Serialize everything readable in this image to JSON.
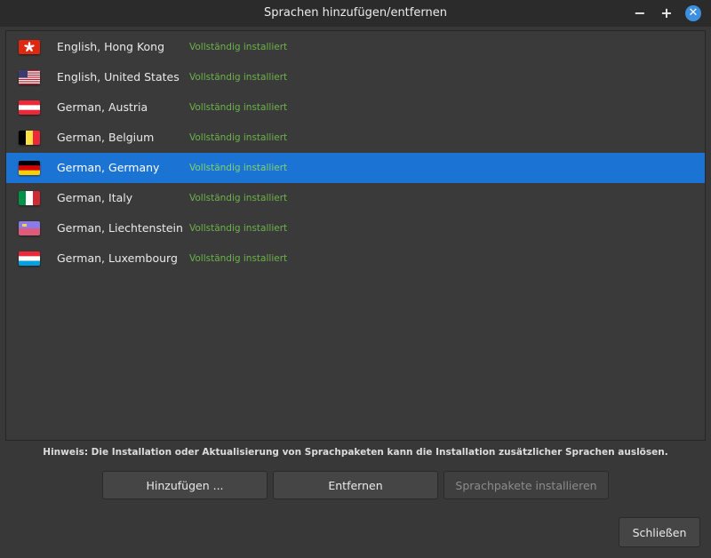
{
  "window": {
    "title": "Sprachen hinzufügen/entfernen",
    "minimize_glyph": "−",
    "maximize_glyph": "+",
    "close_glyph": "✕"
  },
  "languages": [
    {
      "name": "English, Hong Kong",
      "status": "Vollständig installiert",
      "flag": "hk-flag-icon",
      "selected": false
    },
    {
      "name": "English, United States",
      "status": "Vollständig installiert",
      "flag": "us-flag-icon",
      "selected": false
    },
    {
      "name": "German, Austria",
      "status": "Vollständig installiert",
      "flag": "at-flag-icon",
      "selected": false
    },
    {
      "name": "German, Belgium",
      "status": "Vollständig installiert",
      "flag": "be-flag-icon",
      "selected": false
    },
    {
      "name": "German, Germany",
      "status": "Vollständig installiert",
      "flag": "de-flag-icon",
      "selected": true
    },
    {
      "name": "German, Italy",
      "status": "Vollständig installiert",
      "flag": "it-flag-icon",
      "selected": false
    },
    {
      "name": "German, Liechtenstein",
      "status": "Vollständig installiert",
      "flag": "li-flag-icon",
      "selected": false
    },
    {
      "name": "German, Luxembourg",
      "status": "Vollständig installiert",
      "flag": "lu-flag-icon",
      "selected": false
    }
  ],
  "hint": "Hinweis: Die Installation oder Aktualisierung von Sprachpaketen kann die Installation zusätzlicher Sprachen auslösen.",
  "buttons": {
    "add": "Hinzufügen ...",
    "remove": "Entfernen",
    "install": "Sprachpakete installieren",
    "close": "Schließen"
  },
  "colors": {
    "selection": "#1b74d4",
    "status_green": "#6cb24a",
    "close_accent": "#3d8fe0"
  }
}
